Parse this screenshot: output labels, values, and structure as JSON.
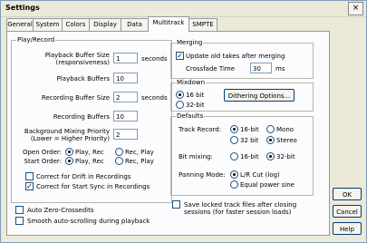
{
  "window": {
    "title": "Settings",
    "close_glyph": "×"
  },
  "tabs": [
    "General",
    "System",
    "Colors",
    "Display",
    "Data",
    "Multitrack",
    "SMPTE"
  ],
  "playback": {
    "group_label": "Play/Record",
    "buffer_size_label": "Playback Buffer Size",
    "buffer_size_sub": "(responsiveness)",
    "buffer_size_value": "1",
    "buffer_size_unit": "seconds",
    "buffers_label": "Playback Buffers",
    "buffers_value": "10",
    "rec_buffer_label": "Recording Buffer Size",
    "rec_buffer_value": "2",
    "rec_buffer_unit": "seconds",
    "rec_buffers_label": "Recording Buffers",
    "rec_buffers_value": "10",
    "bg_priority_label": "Background Mixing Priority",
    "bg_priority_sub": "(Lower = Higher Priority)",
    "bg_priority_value": "2",
    "open_order_label": "Open Order:",
    "start_order_label": "Start Order:",
    "play_rec_label": "Play, Rec",
    "rec_play_label": "Rec, Play",
    "correct_drift_label": "Correct for Drift in Recordings",
    "correct_start_label": "Correct for Start Sync in Recordings",
    "auto_zero_label": "Auto Zero-Crossedits",
    "smooth_scroll_label": "Smooth auto-scrolling during playback",
    "save_locked_label": "Save locked track files after closing",
    "save_locked_sub": "sessions (for faster session loads)"
  },
  "merging": {
    "group_label": "Merging",
    "update_label": "Update old takes after merging",
    "crossfade_label": "Crossfade Time",
    "crossfade_value": "30",
    "crossfade_unit": "ms"
  },
  "mixdown": {
    "group_label": "Mixdown",
    "bit16_label": "16 bit",
    "bit32_label": "32-bit",
    "dither_button": "Dithering Options..."
  },
  "defaults": {
    "group_label": "Defaults",
    "track_record_label": "Track Record:",
    "bit16_label": "16-bit",
    "mono_label": "Mono",
    "bit32_label": "32 bit",
    "stereo_label": "Stereo",
    "bit32b_label": "32-bit",
    "mixing_label": "Bit mixing:",
    "panning_label": "Panning Mode:",
    "lr_cut_label": "L/R Cut (log)",
    "equal_power_label": "Equal power sine"
  },
  "buttons": {
    "ok": "OK",
    "cancel": "Cancel",
    "help": "Help"
  }
}
